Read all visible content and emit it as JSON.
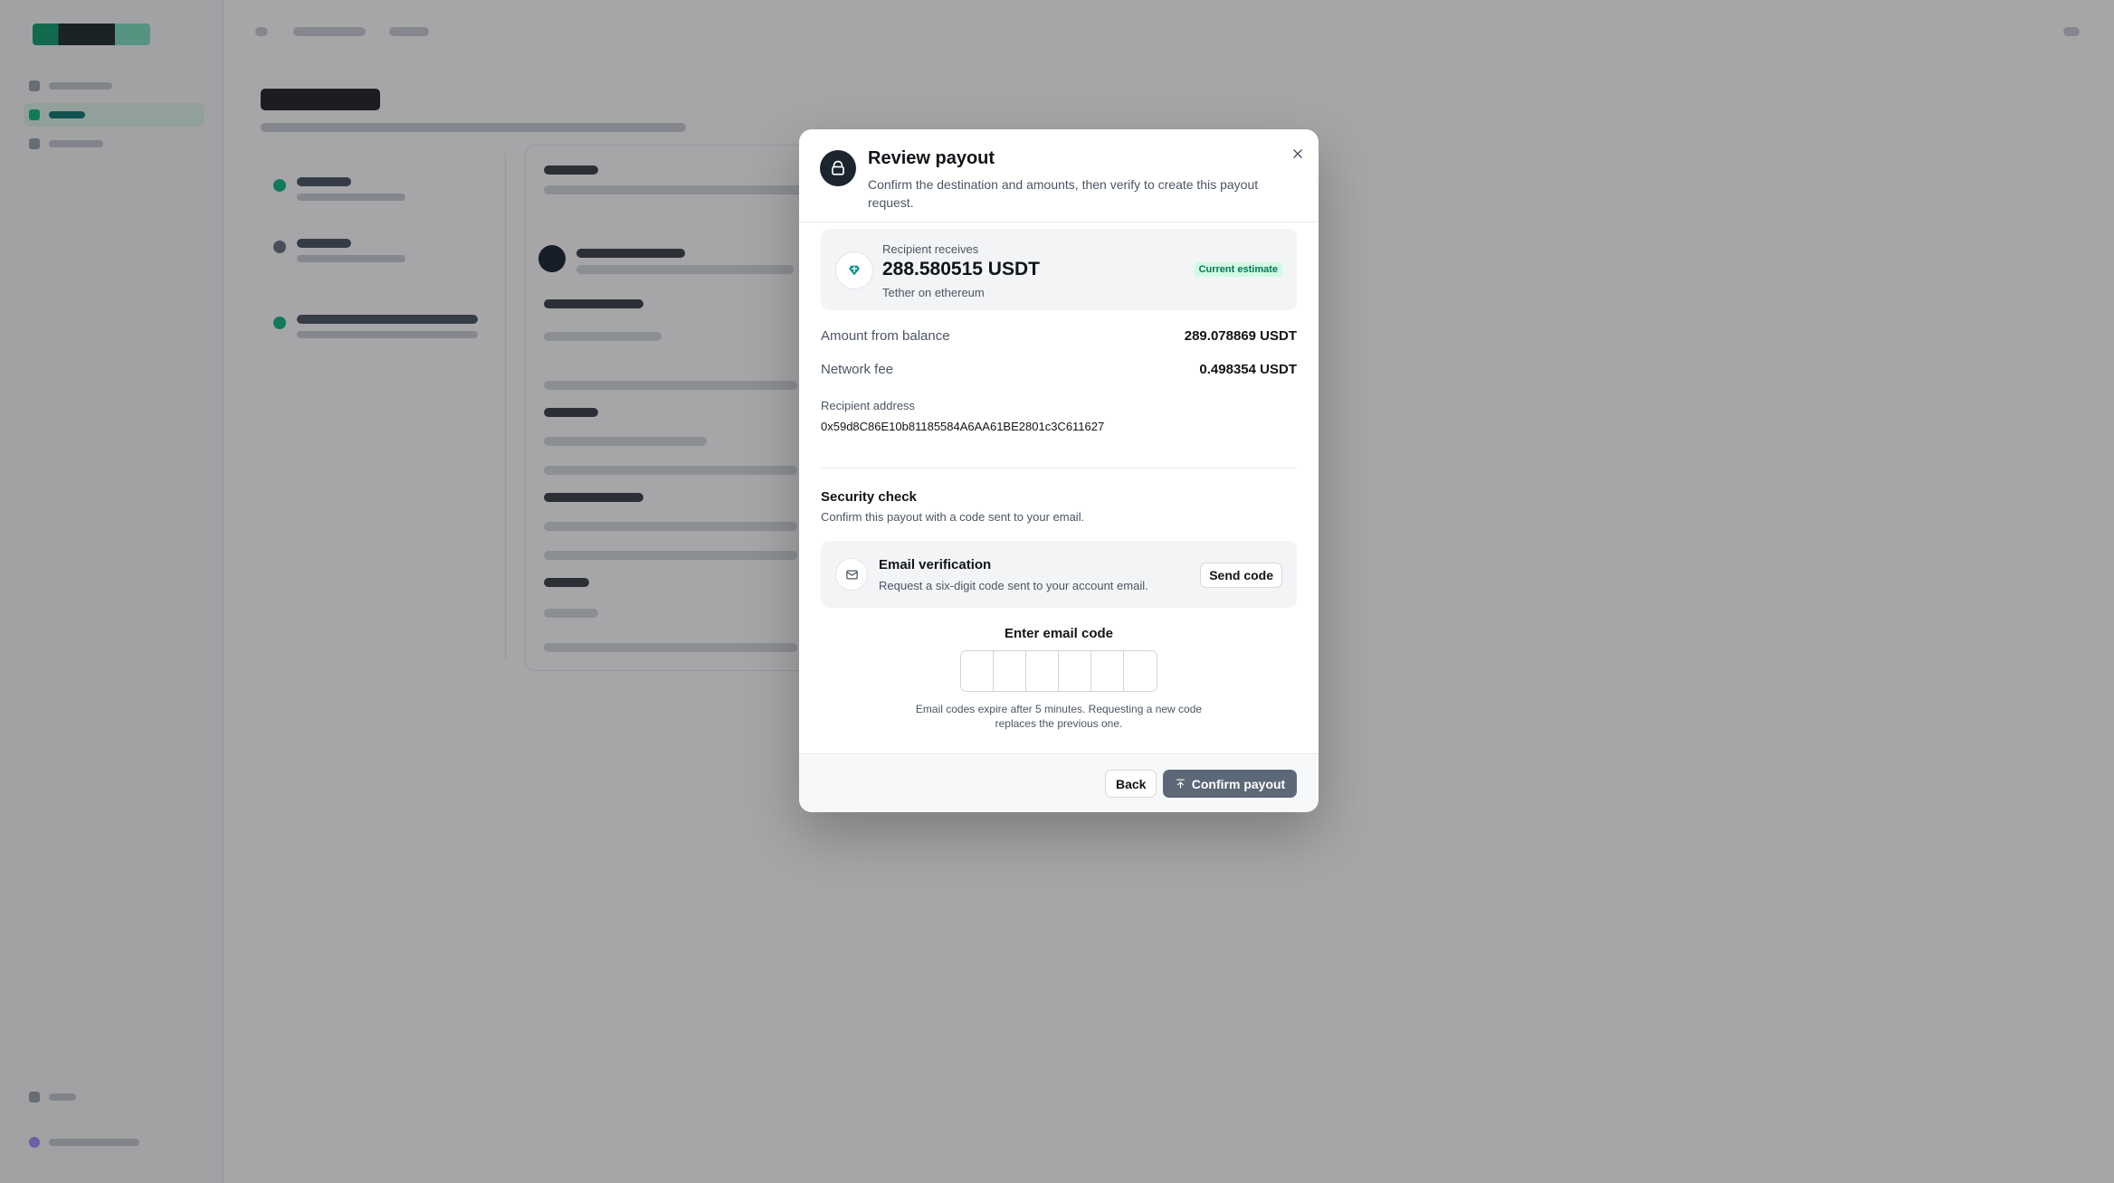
{
  "modal": {
    "title": "Review payout",
    "subtitle": "Confirm the destination and amounts, then verify to create this payout request.",
    "icons": {
      "header": "lock-icon",
      "close": "close-icon"
    },
    "recipient": {
      "label": "Recipient receives",
      "amount": "288.580515 USDT",
      "network": "Tether on ethereum",
      "badge": "Current estimate",
      "icon": "tether-diamond-icon"
    },
    "rows": [
      {
        "label": "Amount from balance",
        "value": "289.078869 USDT"
      },
      {
        "label": "Network fee",
        "value": "0.498354 USDT"
      }
    ],
    "address": {
      "label": "Recipient address",
      "value": "0x59d8C86E10b81185584A6AA61BE2801c3C611627"
    },
    "security": {
      "title": "Security check",
      "subtitle": "Confirm this payout with a code sent to your email.",
      "email": {
        "icon": "mail-icon",
        "title": "Email verification",
        "subtitle": "Request a six-digit code sent to your account email.",
        "send_label": "Send code"
      },
      "code_label": "Enter email code",
      "code_digits": [
        "",
        "",
        "",
        "",
        "",
        ""
      ],
      "help": "Email codes expire after 5 minutes. Requesting a new code replaces the previous one."
    },
    "footer": {
      "back_label": "Back",
      "confirm_label": "Confirm payout",
      "confirm_icon": "arrow-up-icon"
    }
  },
  "colors": {
    "accent": "#10b981",
    "modal_icon_bg": "#1c2430",
    "confirm_button": "#5c6877",
    "badge_bg": "#d1fae5",
    "badge_text": "#047857",
    "overlay": "rgba(20,22,26,0.38)"
  }
}
